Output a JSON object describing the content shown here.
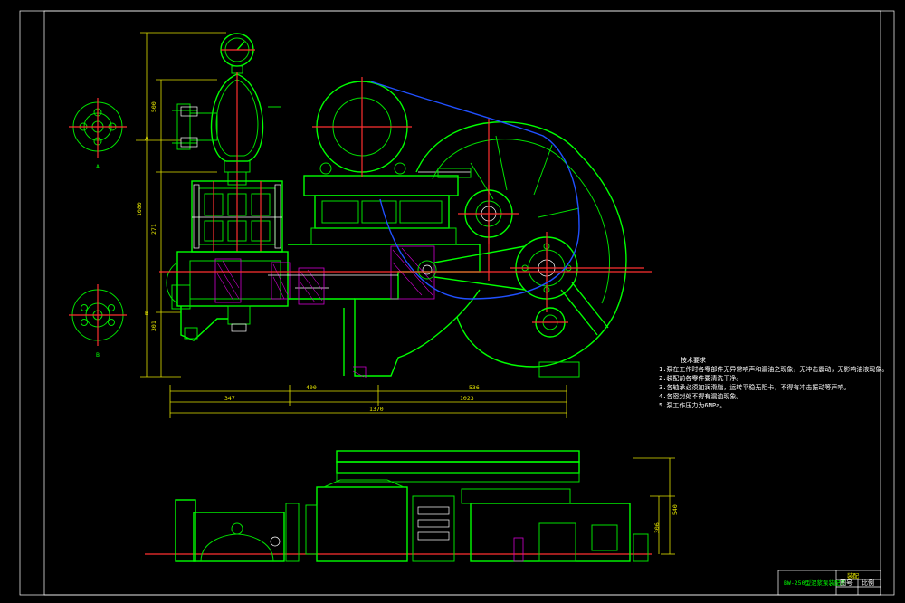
{
  "drawing": {
    "dimensions": {
      "d500": "500",
      "d1080": "1080",
      "d271": "271",
      "d301": "301",
      "d347": "347",
      "d400": "400",
      "d536": "536",
      "d1023": "1023",
      "d1370": "1370",
      "d306": "306",
      "d540": "540"
    },
    "view_labels": {
      "a_top": "A",
      "a_side": "A",
      "b_side": "B",
      "b_bottom": "B"
    },
    "notes": {
      "title": "技术要求",
      "lines": [
        "1.泵在工作时各零部件无异常响声和漏油之现象，无冲击震动，无影响油液现象。",
        "2.装配前各零件要清洗干净。",
        "3.各轴承必须加润滑脂，运转平稳无阻卡，不得有冲击振动等声响。",
        "4.各密封处不得有漏油现象。",
        "5.泵工作压力为6MPa。"
      ]
    },
    "title_block": {
      "name": "BW-250型泥浆泵装配图",
      "cell_a": "装配",
      "cell_b": "图号",
      "cell_c": "比例"
    }
  }
}
